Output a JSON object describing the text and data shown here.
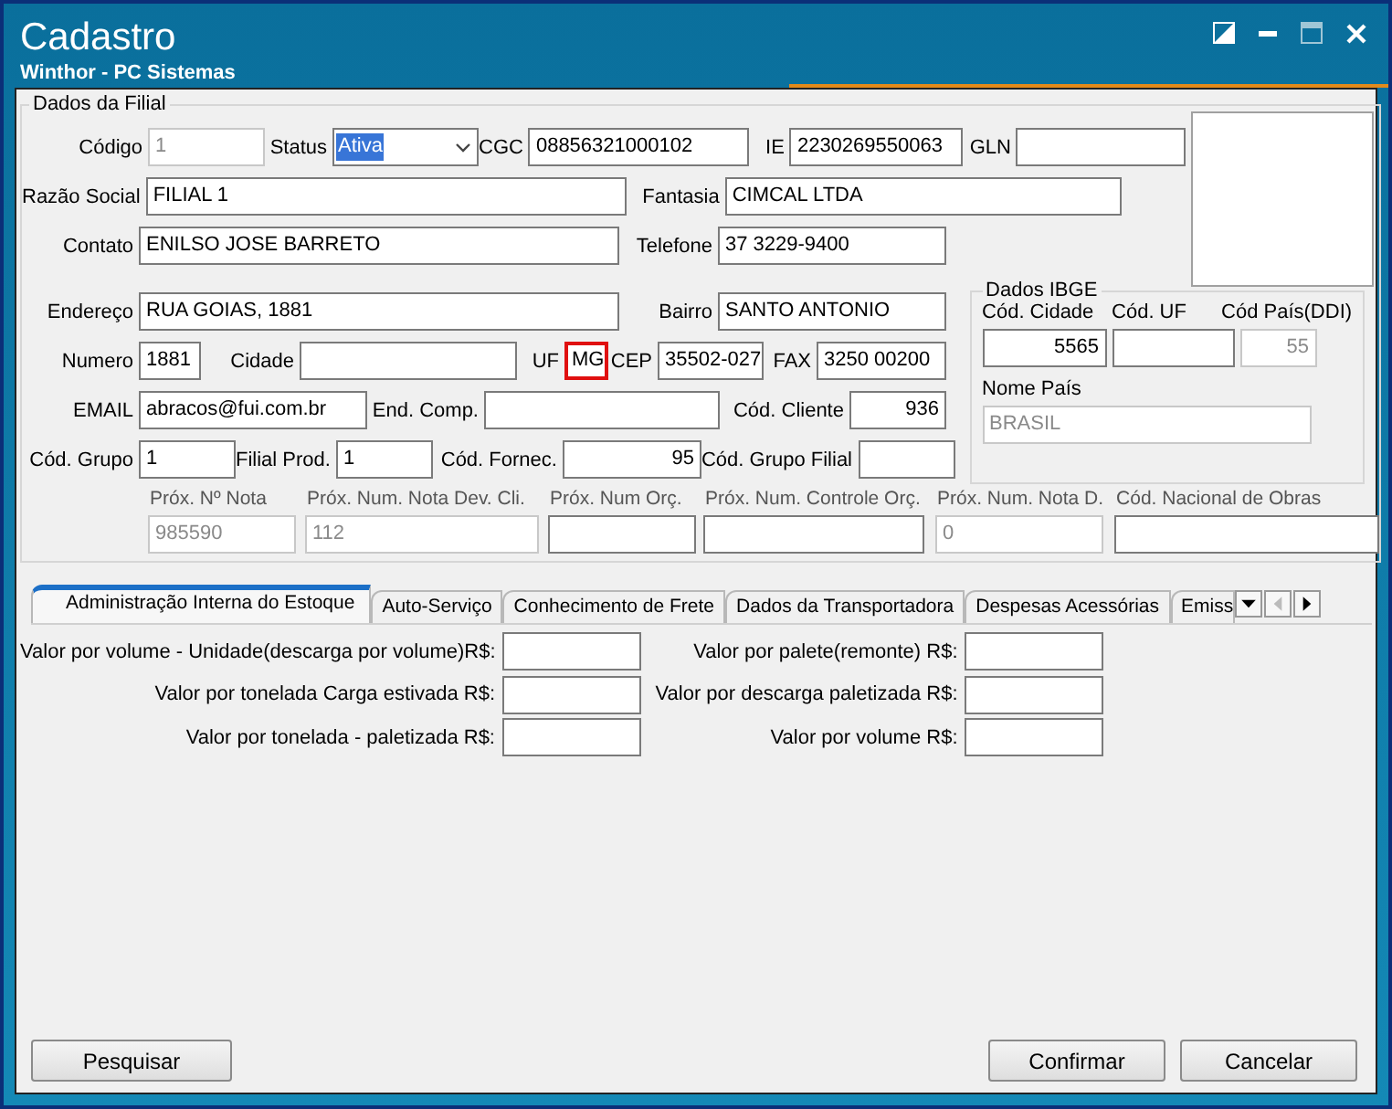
{
  "window": {
    "title": "Cadastro",
    "subtitle": "Winthor - PC Sistemas"
  },
  "dados_filial": {
    "title": "Dados da Filial",
    "lines": [
      {
        "fields": [
          {
            "label": "Código",
            "value": "1",
            "kind": "text",
            "disabled": true,
            "highlighted": false
          },
          {
            "label": "Status",
            "value": "Ativa",
            "kind": "select",
            "disabled": false,
            "highlighted": false
          },
          {
            "label": "CGC",
            "value": "08856321000102",
            "kind": "text",
            "disabled": false,
            "highlighted": false
          },
          {
            "label": "IE",
            "value": "2230269550063",
            "kind": "text",
            "disabled": false,
            "highlighted": false
          },
          {
            "label": "GLN",
            "kind": "text",
            "disabled": false,
            "highlighted": false
          }
        ]
      },
      {
        "fields": [
          {
            "label": "Razão Social",
            "value": "FILIAL 1",
            "kind": "text",
            "disabled": false,
            "highlighted": false
          },
          {
            "label": "Fantasia",
            "value": "CIMCAL LTDA",
            "kind": "text",
            "disabled": false,
            "highlighted": false
          }
        ]
      },
      {
        "fields": [
          {
            "label": "Contato",
            "value": "ENILSO JOSE BARRETO",
            "kind": "text",
            "disabled": false,
            "highlighted": false
          },
          {
            "label": "Telefone",
            "value": "37 3229-9400",
            "kind": "text",
            "disabled": false,
            "highlighted": false
          }
        ]
      },
      {
        "fields": [
          {
            "label": "Endereço",
            "value": "RUA GOIAS, 1881",
            "kind": "text",
            "disabled": false,
            "highlighted": false
          },
          {
            "label": "Bairro",
            "value": "SANTO ANTONIO",
            "kind": "text",
            "disabled": false,
            "highlighted": false
          }
        ]
      },
      {
        "fields": [
          {
            "label": "Numero",
            "value": "1881",
            "kind": "text",
            "disabled": false,
            "highlighted": false
          },
          {
            "label": "Cidade",
            "kind": "text",
            "disabled": false,
            "highlighted": false
          },
          {
            "label": "UF",
            "value": "MG",
            "kind": "text",
            "disabled": false,
            "highlighted": true
          },
          {
            "label": "CEP",
            "value": "35502-027",
            "kind": "text",
            "disabled": false,
            "highlighted": false
          },
          {
            "label": "FAX",
            "value": "3250 00200",
            "kind": "text",
            "disabled": false,
            "highlighted": false
          }
        ]
      },
      {
        "fields": [
          {
            "label": "EMAIL",
            "value": "abracos@fui.com.br",
            "kind": "text",
            "disabled": false,
            "highlighted": false
          },
          {
            "label": "End. Comp.",
            "kind": "text",
            "disabled": false,
            "highlighted": false
          },
          {
            "label": "Cód. Cliente",
            "value": "936",
            "kind": "number",
            "disabled": false,
            "highlighted": false
          }
        ]
      },
      {
        "fields": [
          {
            "label": "Cód. Grupo",
            "value": "1",
            "kind": "text",
            "disabled": false,
            "highlighted": false
          },
          {
            "label": "Filial Prod.",
            "value": "1",
            "kind": "text",
            "disabled": false,
            "highlighted": false
          },
          {
            "label": "Cód. Fornec.",
            "value": "95",
            "kind": "number",
            "disabled": false,
            "highlighted": false
          },
          {
            "label": "Cód. Grupo Filial",
            "kind": "text",
            "disabled": false,
            "highlighted": false
          }
        ]
      }
    ],
    "dados_ibge": {
      "title": "Dados IBGE",
      "fields": [
        {
          "label": "Cód. Cidade",
          "value": "5565",
          "kind": "number",
          "disabled": false
        },
        {
          "label": "Cód. UF",
          "kind": "text",
          "disabled": false
        },
        {
          "label": "Cód País(DDI)",
          "value": "55",
          "kind": "number",
          "disabled": true
        },
        {
          "label": "Nome País",
          "value": "BRASIL",
          "kind": "text",
          "disabled": true
        }
      ]
    },
    "proximos": [
      {
        "label": "Próx. Nº Nota",
        "value": "985590",
        "disabled": true
      },
      {
        "label": "Próx. Num. Nota Dev. Cli.",
        "value": "112",
        "disabled": true
      },
      {
        "label": "Próx. Num Orç.",
        "disabled": false
      },
      {
        "label": "Próx. Num. Controle Orç.",
        "disabled": false
      },
      {
        "label": "Próx. Num. Nota D.",
        "value": "0",
        "disabled": true
      },
      {
        "label": "Cód. Nacional de Obras",
        "disabled": false
      }
    ]
  },
  "tabs": [
    {
      "label": "Administração Interna do Estoque",
      "selected": true
    },
    {
      "label": "Auto-Serviço",
      "selected": false
    },
    {
      "label": "Conhecimento de Frete",
      "selected": false
    },
    {
      "label": "Dados da Transportadora",
      "selected": false
    },
    {
      "label": "Despesas Acessórias",
      "selected": false
    },
    {
      "label": "Emiss",
      "selected": false
    }
  ],
  "tab_fields": {
    "left": [
      {
        "label": "Valor por volume - Unidade(descarga por volume)R$:"
      },
      {
        "label": "Valor por tonelada Carga estivada R$:"
      },
      {
        "label": "Valor por tonelada - paletizada R$:"
      }
    ],
    "right": [
      {
        "label": "Valor por palete(remonte) R$:"
      },
      {
        "label": "Valor por descarga paletizada R$:"
      },
      {
        "label": "Valor por volume R$:"
      }
    ]
  },
  "buttons": {
    "left": [
      {
        "label": "Pesquisar"
      }
    ],
    "right": [
      {
        "label": "Confirmar"
      },
      {
        "label": "Cancelar"
      }
    ]
  }
}
